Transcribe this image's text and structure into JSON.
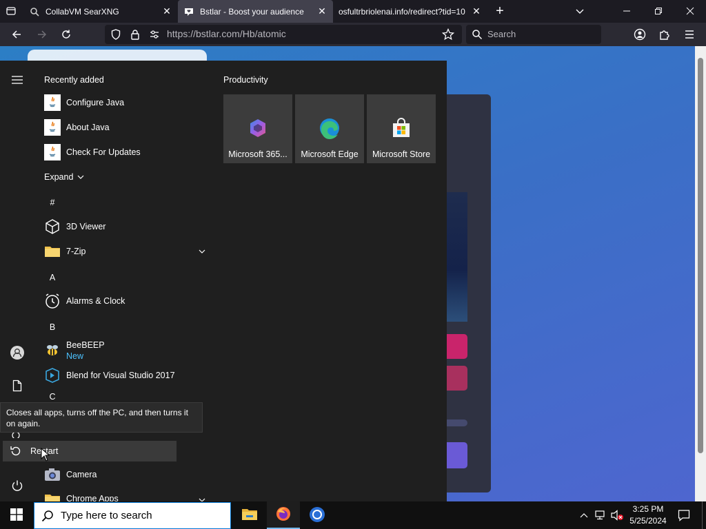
{
  "browser": {
    "tabs": [
      {
        "title": "CollabVM SearXNG",
        "close": "✕"
      },
      {
        "title": "Bstlar - Boost your audience",
        "close": "✕",
        "active": true
      },
      {
        "title": "osfultrbriolenai.info/redirect?tid=10",
        "close": "✕"
      }
    ],
    "new_tab": "+",
    "url": "https://bstlar.com/Hb/atomic",
    "search_placeholder": "Search"
  },
  "start_menu": {
    "recently_added_heading": "Recently added",
    "recent": [
      {
        "label": "Configure Java"
      },
      {
        "label": "About Java"
      },
      {
        "label": "Check For Updates"
      }
    ],
    "expand_label": "Expand",
    "groups": {
      "hash": "#",
      "a": "A",
      "b": "B",
      "c": "C"
    },
    "apps": {
      "viewer3d": "3D Viewer",
      "zip7": "7-Zip",
      "alarms": "Alarms & Clock",
      "beebeep": "BeeBEEP",
      "beebeep_badge": "New",
      "blend": "Blend for Visual Studio 2017",
      "camera": "Camera",
      "chrome_apps": "Chrome Apps"
    },
    "productivity_heading": "Productivity",
    "tiles": [
      {
        "label": "Microsoft 365..."
      },
      {
        "label": "Microsoft Edge"
      },
      {
        "label": "Microsoft Store"
      }
    ],
    "tooltip": "Closes all apps, turns off the PC, and then turns it on again.",
    "restart_label": "Restart"
  },
  "taskbar": {
    "search_placeholder": "Type here to search",
    "time": "3:25 PM",
    "date": "5/25/2024"
  },
  "page": {
    "fragment": "!"
  },
  "colors": {
    "accent": "#0078d7",
    "start_bg": "#1f1f1f",
    "tile_bg": "#3c3c3c"
  }
}
